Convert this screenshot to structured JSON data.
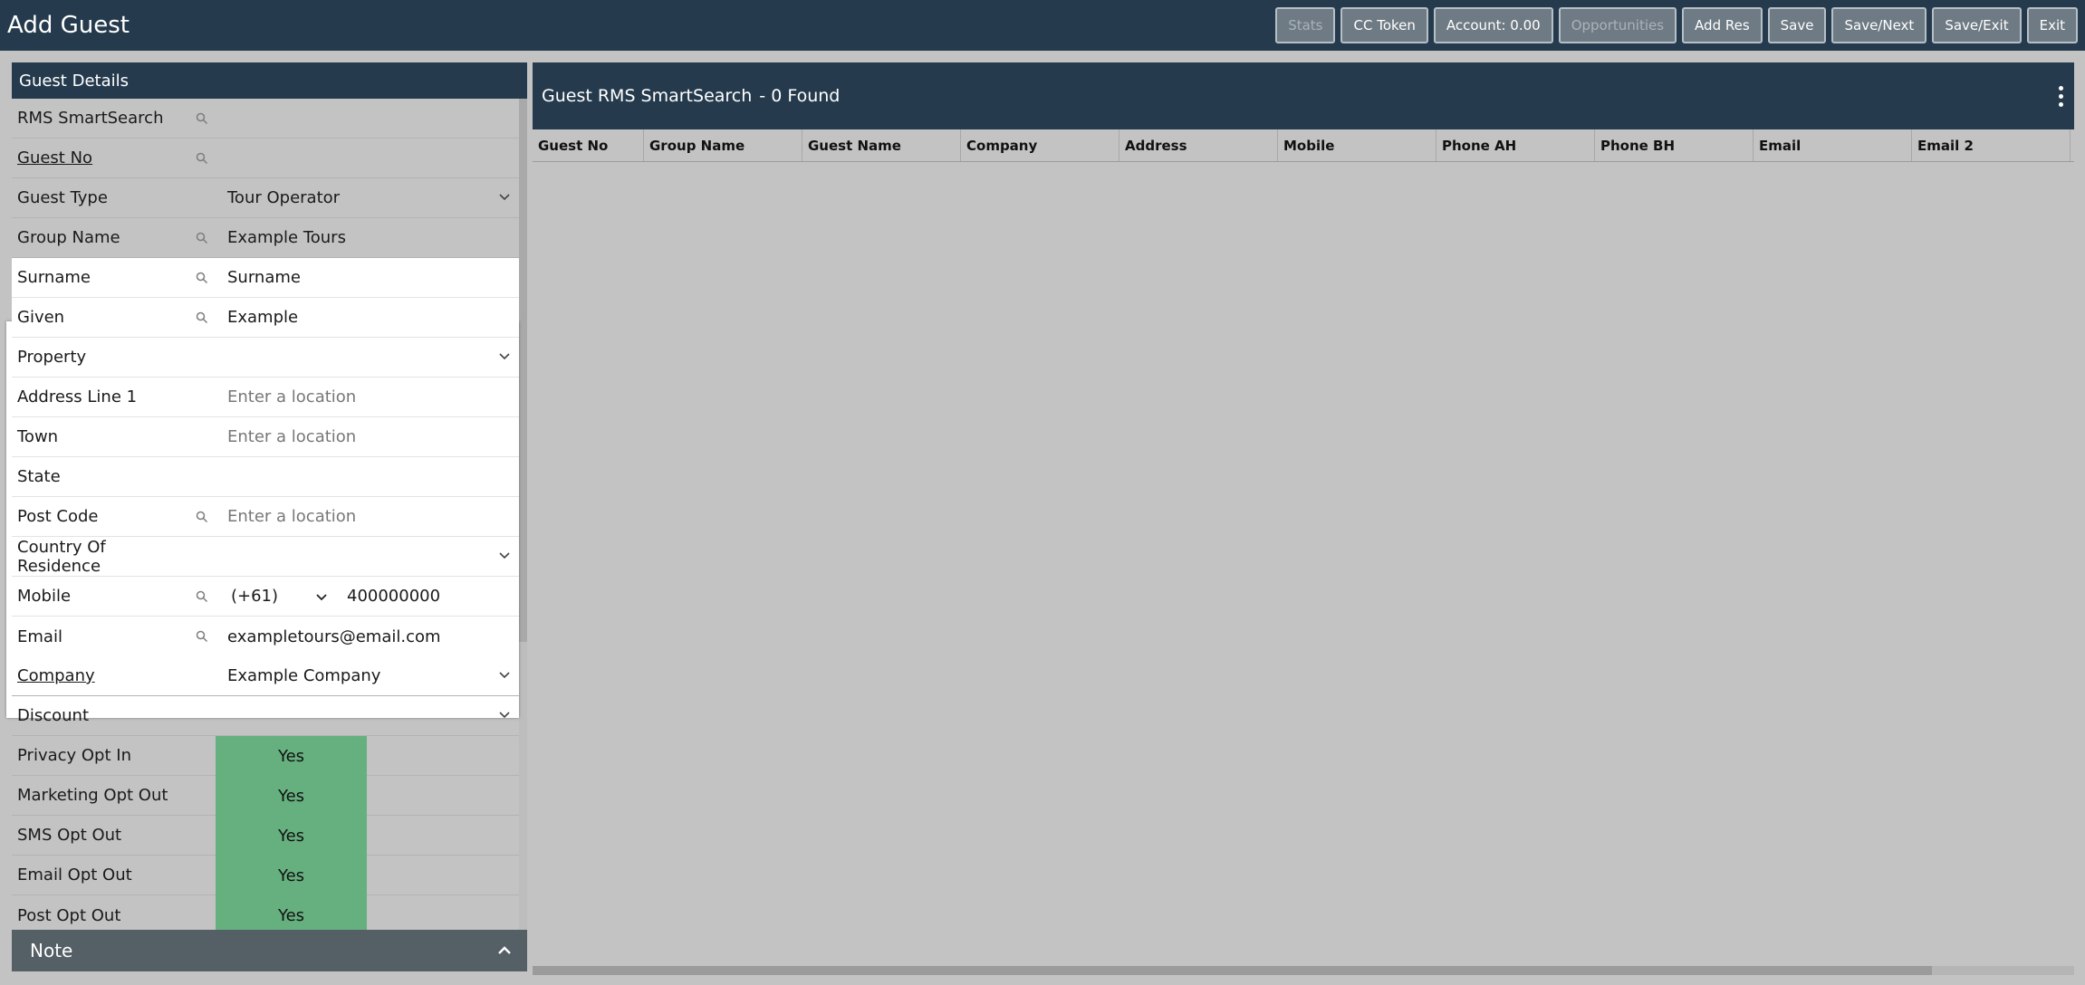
{
  "window": {
    "title": "Add Guest"
  },
  "toolbar": {
    "buttons": [
      {
        "label": "Stats",
        "enabled": false
      },
      {
        "label": "CC Token",
        "enabled": true
      },
      {
        "label": "Account: 0.00",
        "enabled": true
      },
      {
        "label": "Opportunities",
        "enabled": false
      },
      {
        "label": "Add Res",
        "enabled": true
      },
      {
        "label": "Save",
        "enabled": true
      },
      {
        "label": "Save/Next",
        "enabled": true
      },
      {
        "label": "Save/Exit",
        "enabled": true
      },
      {
        "label": "Exit",
        "enabled": true
      }
    ]
  },
  "guest_details": {
    "header": "Guest Details",
    "fields": {
      "smartsearch": {
        "label": "RMS SmartSearch",
        "value": ""
      },
      "guest_no": {
        "label": "Guest No",
        "value": ""
      },
      "guest_type": {
        "label": "Guest Type",
        "value": "Tour Operator"
      },
      "group_name": {
        "label": "Group Name",
        "value": "Example Tours"
      },
      "surname": {
        "label": "Surname",
        "value": "Surname"
      },
      "given": {
        "label": "Given",
        "value": "Example"
      },
      "property": {
        "label": "Property",
        "value": ""
      },
      "address_line_1": {
        "label": "Address Line 1",
        "placeholder": "Enter a location"
      },
      "town": {
        "label": "Town",
        "placeholder": "Enter a location"
      },
      "state": {
        "label": "State",
        "value": ""
      },
      "post_code": {
        "label": "Post Code",
        "placeholder": "Enter a location"
      },
      "country": {
        "label": "Country Of Residence",
        "value": ""
      },
      "mobile": {
        "label": "Mobile",
        "code": "(+61)",
        "number": "400000000"
      },
      "email": {
        "label": "Email",
        "value": "exampletours@email.com"
      },
      "company": {
        "label": "Company",
        "value": "Example Company"
      },
      "discount": {
        "label": "Discount",
        "value": ""
      },
      "privacy_opt_in": {
        "label": "Privacy Opt In",
        "value": "Yes"
      },
      "marketing_opt_out": {
        "label": "Marketing Opt Out",
        "value": "Yes"
      },
      "sms_opt_out": {
        "label": "SMS Opt Out",
        "value": "Yes"
      },
      "email_opt_out": {
        "label": "Email Opt Out",
        "value": "Yes"
      },
      "post_opt_out": {
        "label": "Post Opt Out",
        "value": "Yes"
      }
    },
    "note": {
      "label": "Note"
    }
  },
  "smartsearch_panel": {
    "title": "Guest RMS SmartSearch",
    "found": "- 0 Found",
    "columns": [
      "Guest No",
      "Group Name",
      "Guest Name",
      "Company",
      "Address",
      "Mobile",
      "Phone AH",
      "Phone BH",
      "Email",
      "Email 2"
    ]
  },
  "colors": {
    "header_bg": "#253b4d",
    "toggle_yes": "#66b07f",
    "background": "#c3c3c3"
  }
}
